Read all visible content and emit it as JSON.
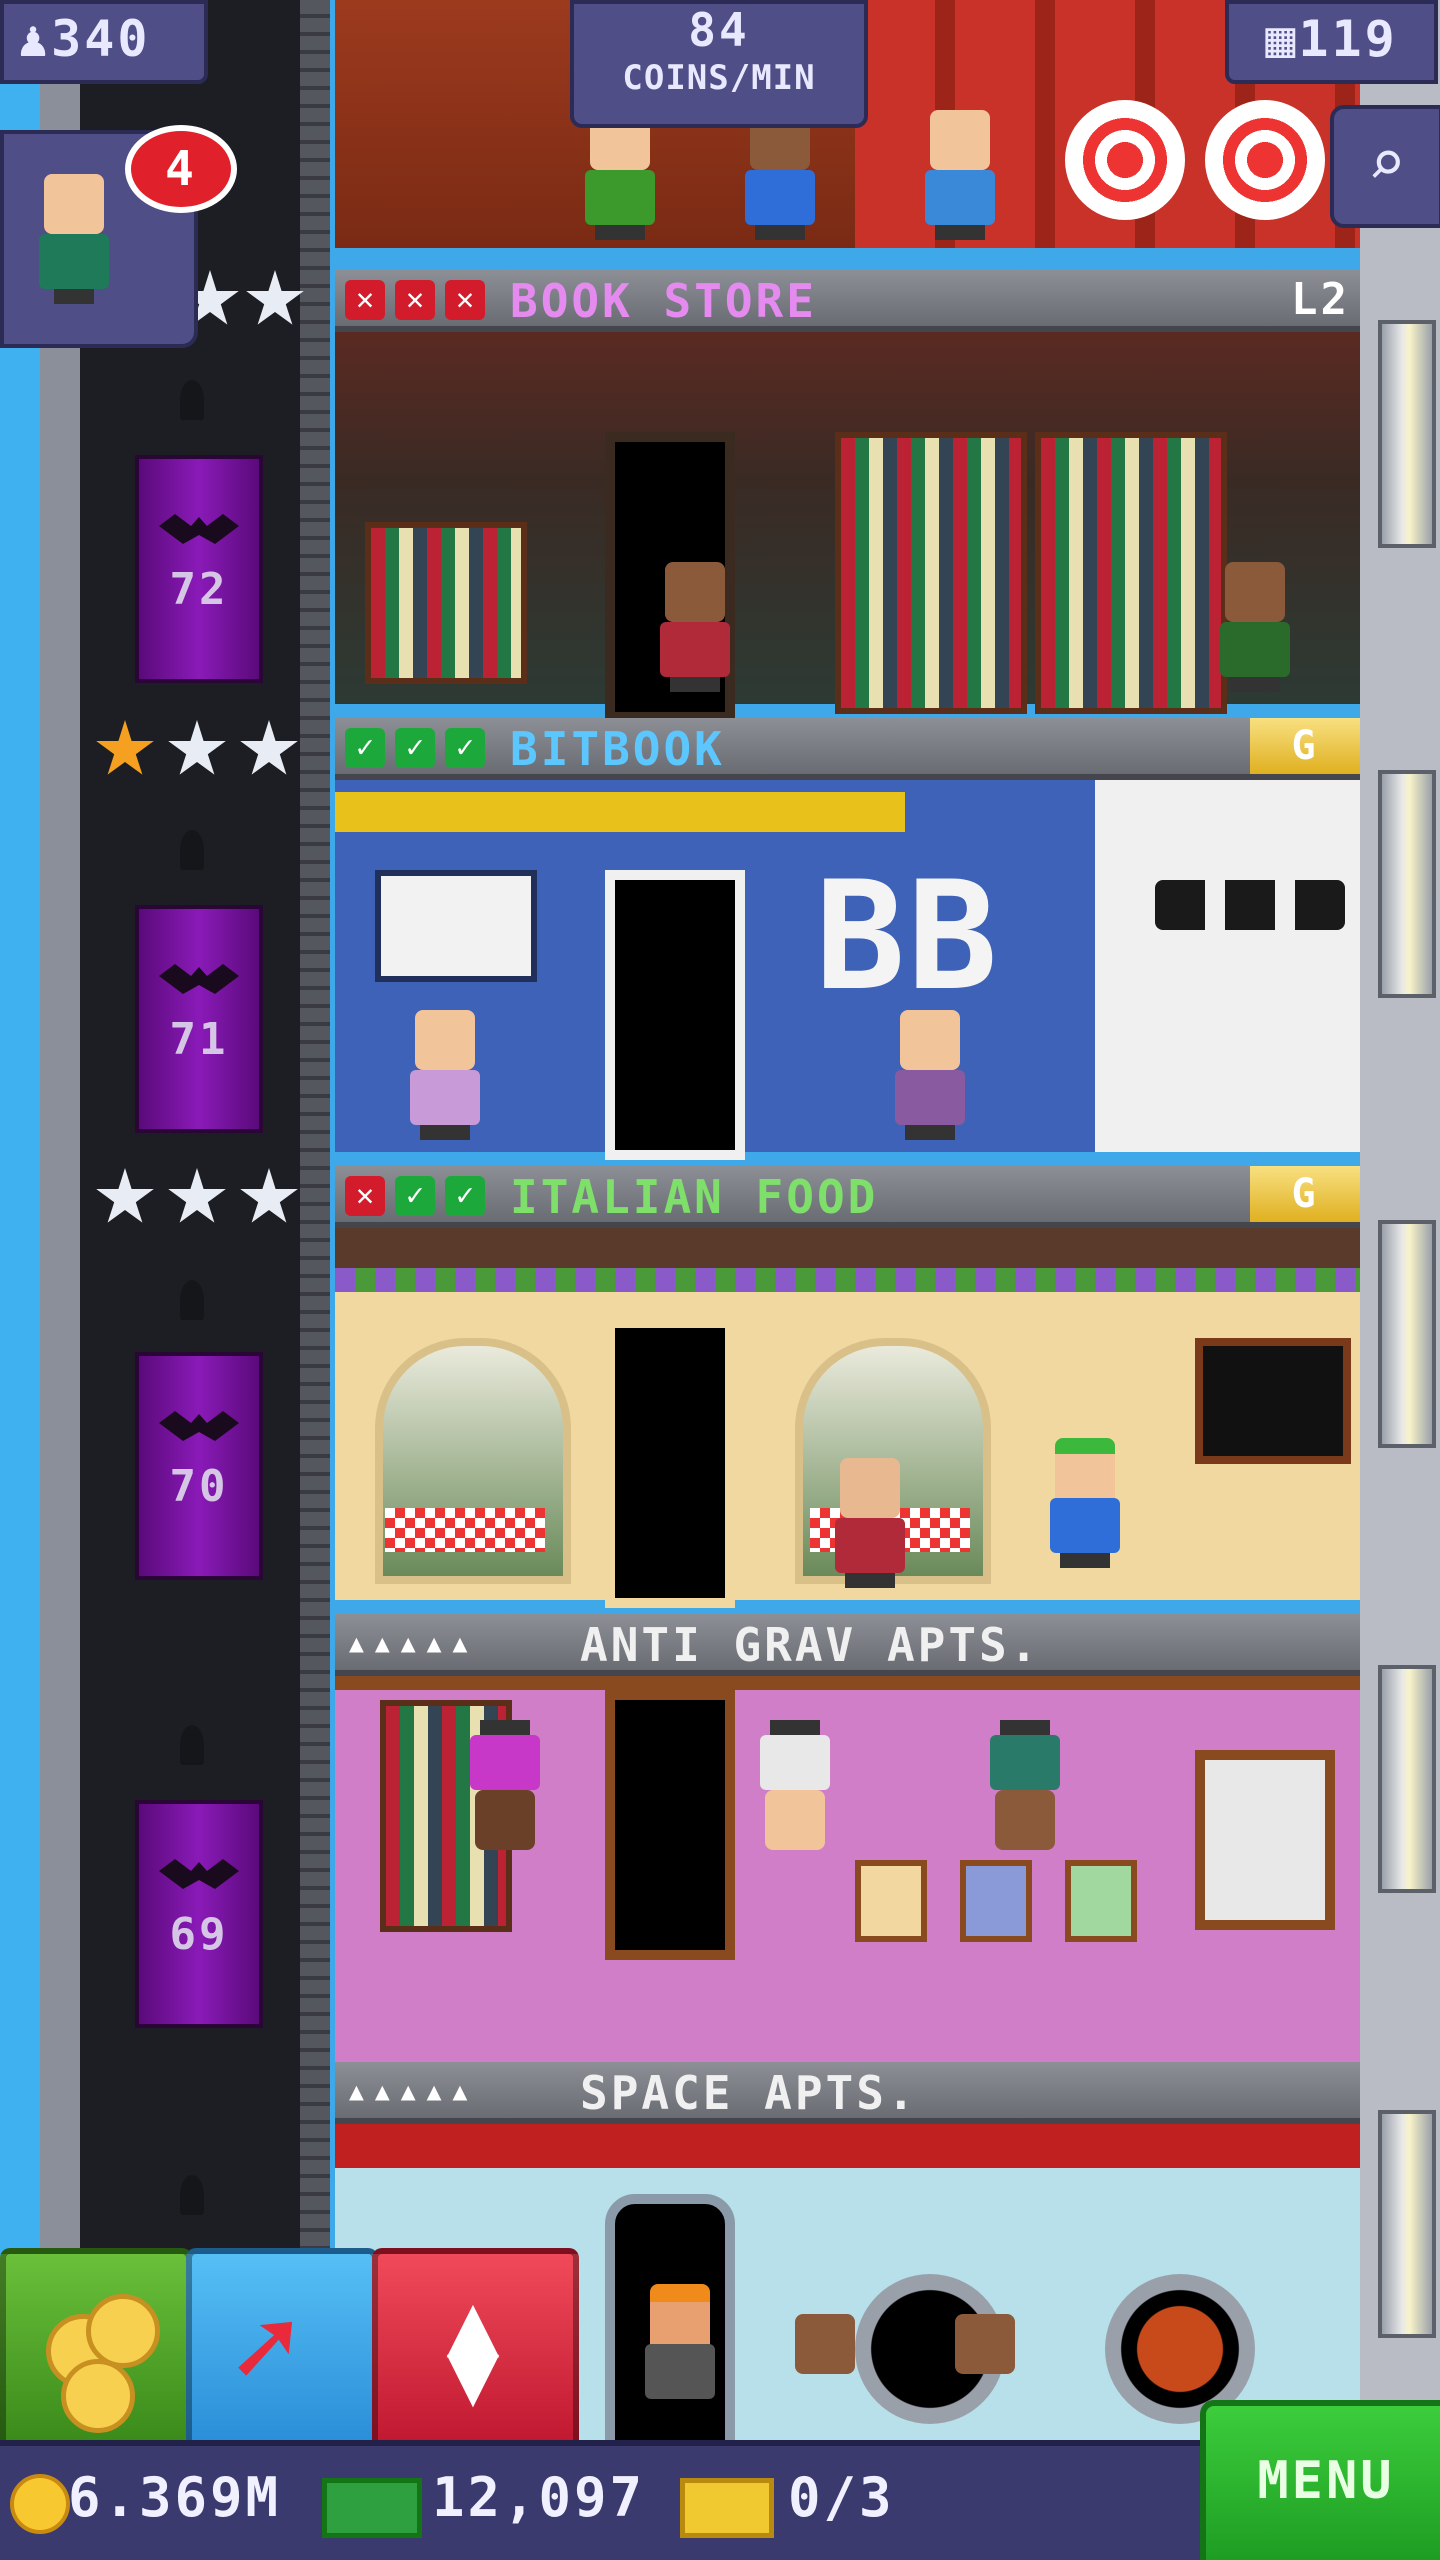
{
  "hud": {
    "population": "340",
    "coins_per_min_value": "84",
    "coins_per_min_label": "COINS/MIN",
    "floors": "119",
    "notification_count": "4"
  },
  "elevator": {
    "floor_numbers": [
      "72",
      "71",
      "70",
      "69"
    ]
  },
  "floors": [
    {
      "name": "BOOK STORE",
      "marks": [
        "x",
        "x",
        "x"
      ],
      "level": "L2",
      "stars": [
        "silver",
        "silver"
      ],
      "name_color": "#e58bf0"
    },
    {
      "name": "BITBOOK",
      "marks": [
        "c",
        "c",
        "c"
      ],
      "tag": "G",
      "stars": [
        "gold",
        "silver",
        "silver"
      ],
      "name_color": "#5cc7ff"
    },
    {
      "name": "ITALIAN FOOD",
      "marks": [
        "x",
        "c",
        "c"
      ],
      "tag": "G",
      "stars": [
        "silver",
        "silver",
        "silver"
      ],
      "name_color": "#7ee06a"
    },
    {
      "name": "ANTI GRAV APTS.",
      "residents": "▴▴▴▴▴",
      "name_color": "#f0f0f0"
    },
    {
      "name": "SPACE APTS.",
      "residents": "▴▴▴▴▴",
      "name_color": "#f0f0f0"
    }
  ],
  "bitbook_sign": "BB",
  "bottom_bar": {
    "coins": "6.369M",
    "bux": "12,097",
    "tickets": "0/3",
    "menu_label": "MENU"
  },
  "colors": {
    "sky": "#3fb0f0",
    "hud_chip": "#4f4e86",
    "elevator": "#8a1ab8",
    "menu_green": "#1d9b22",
    "coin_button": "#4a9a1a",
    "arrow_button": "#3aa6f0",
    "elevator_button": "#e03048"
  },
  "icons": [
    "person-icon",
    "building-icon",
    "search-icon",
    "coin-icon",
    "bux-icon",
    "ticket-icon",
    "coins-button-icon",
    "move-arrow-icon",
    "elevator-updown-icon"
  ]
}
